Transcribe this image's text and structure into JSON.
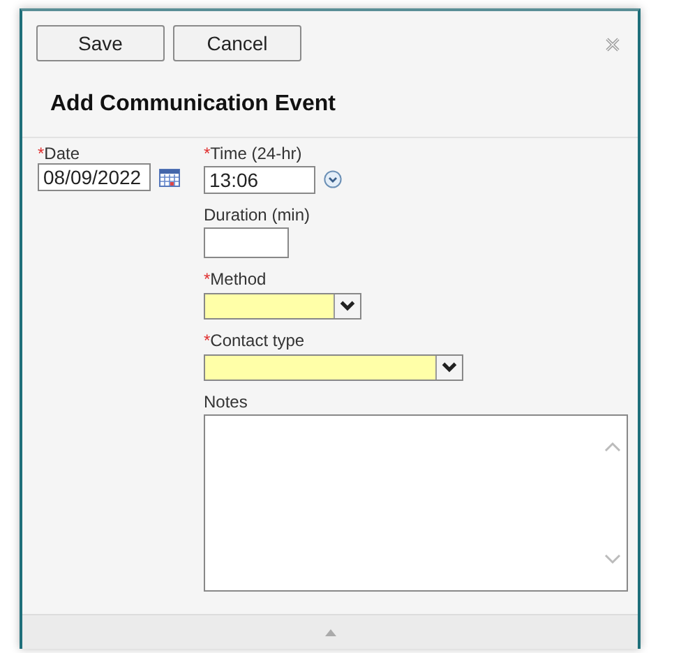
{
  "toolbar": {
    "buttons": [
      {
        "label": "Save"
      },
      {
        "label": "Cancel"
      }
    ]
  },
  "title": "Add Communication Event",
  "fields": [
    {
      "kind": "date",
      "required_mark": "*",
      "label": "Date",
      "value": "08/09/2022"
    },
    {
      "kind": "time",
      "required_mark": "*",
      "label": "Time (24-hr)",
      "value": "13:06"
    },
    {
      "kind": "text",
      "label": "Duration (min)"
    },
    {
      "kind": "select",
      "required_mark": "*",
      "label": "Method",
      "wide": false
    },
    {
      "kind": "select",
      "required_mark": "*",
      "label": "Contact type",
      "wide": true
    },
    {
      "kind": "textarea",
      "label": "Notes"
    }
  ]
}
